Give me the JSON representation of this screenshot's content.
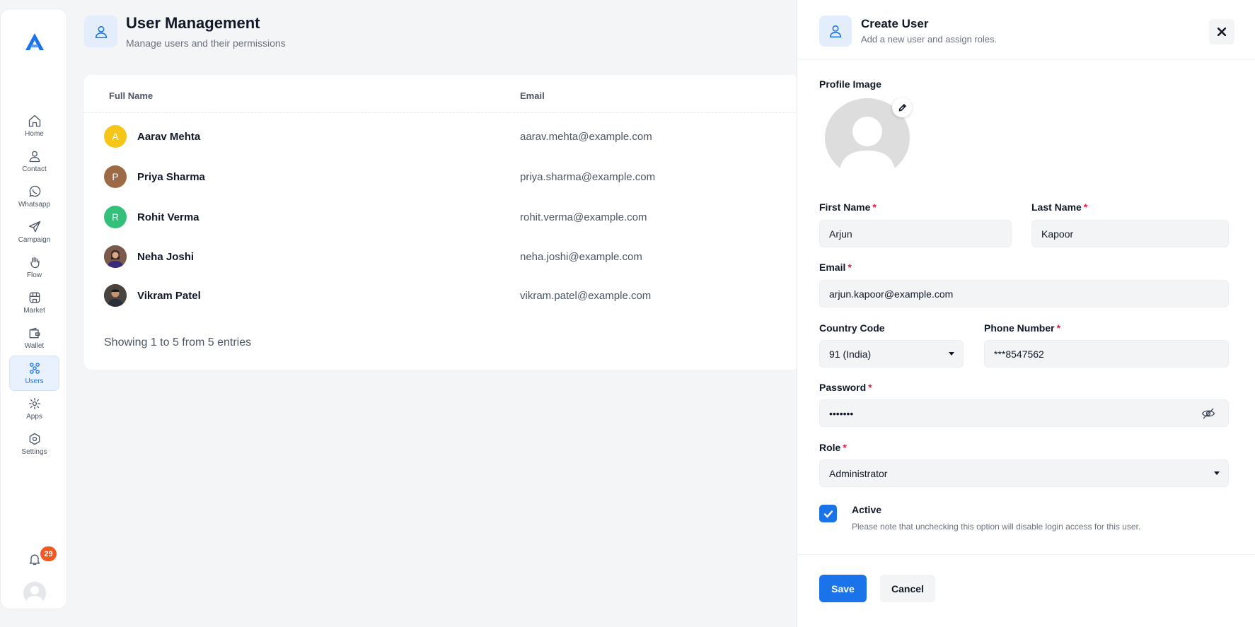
{
  "colors": {
    "accent": "#1a73e8",
    "badge": "#f05a22",
    "required": "#e11d48"
  },
  "sidebar": {
    "logo_icon": "app-logo",
    "items": [
      {
        "label": "Home",
        "icon": "home-icon"
      },
      {
        "label": "Contact",
        "icon": "contact-icon"
      },
      {
        "label": "Whatsapp",
        "icon": "whatsapp-icon"
      },
      {
        "label": "Campaign",
        "icon": "send-icon"
      },
      {
        "label": "Flow",
        "icon": "flow-icon"
      },
      {
        "label": "Market",
        "icon": "store-icon"
      },
      {
        "label": "Wallet",
        "icon": "wallet-icon"
      },
      {
        "label": "Users",
        "icon": "users-icon",
        "active": true
      },
      {
        "label": "Apps",
        "icon": "apps-icon"
      },
      {
        "label": "Settings",
        "icon": "settings-icon"
      }
    ],
    "notifications_count": "29"
  },
  "header": {
    "title": "User Management",
    "subtitle": "Manage users and their permissions"
  },
  "table": {
    "columns": [
      "Full Name",
      "Email"
    ],
    "rows": [
      {
        "initial": "A",
        "name": "Aarav Mehta",
        "email": "aarav.mehta@example.com",
        "avatar_color": "#f5c518"
      },
      {
        "initial": "P",
        "name": "Priya Sharma",
        "email": "priya.sharma@example.com",
        "avatar_color": "#9c6a44"
      },
      {
        "initial": "R",
        "name": "Rohit Verma",
        "email": "rohit.verma@example.com",
        "avatar_color": "#34c07a"
      },
      {
        "initial": "",
        "name": "Neha Joshi",
        "email": "neha.joshi@example.com",
        "avatar_color": "#5b3a2e"
      },
      {
        "initial": "",
        "name": "Vikram Patel",
        "email": "vikram.patel@example.com",
        "avatar_color": "#3b3430"
      }
    ],
    "footer": "Showing 1 to 5 from 5 entries"
  },
  "drawer": {
    "title": "Create User",
    "subtitle": "Add a new user and assign roles.",
    "profile_label": "Profile Image",
    "first_name": {
      "label": "First Name",
      "value": "Arjun"
    },
    "last_name": {
      "label": "Last Name",
      "value": "Kapoor"
    },
    "email": {
      "label": "Email",
      "value": "arjun.kapoor@example.com"
    },
    "country_code": {
      "label": "Country Code",
      "value": "91 (India)"
    },
    "phone": {
      "label": "Phone Number",
      "value": "***8547562"
    },
    "password": {
      "label": "Password",
      "value": "•••••••"
    },
    "role": {
      "label": "Role",
      "value": "Administrator"
    },
    "active": {
      "label": "Active",
      "note": "Please note that unchecking this option will disable login access for this user.",
      "checked": true
    },
    "save_label": "Save",
    "cancel_label": "Cancel",
    "required_mark": "*"
  }
}
